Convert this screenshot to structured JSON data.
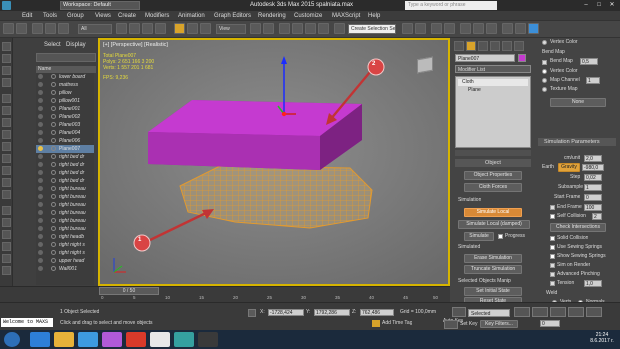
{
  "app": {
    "title": "Autodesk 3ds Max 2015    spalniata.max",
    "workspace": "Workspace: Default",
    "search_placeholder": "Type a keyword or phrase"
  },
  "menu": [
    "Edit",
    "Tools",
    "Group",
    "Views",
    "Create",
    "Modifiers",
    "Animation",
    "Graph Editors",
    "Rendering",
    "Customize",
    "MAXScript",
    "Help"
  ],
  "toolbar": {
    "undo_filter": "All",
    "view_dropdown": "View",
    "selection_set": "Create Selection Se"
  },
  "explorer": {
    "tabs": [
      "Select",
      "Display"
    ],
    "name_header": "Name",
    "items": [
      {
        "label": "lower board",
        "selected": false
      },
      {
        "label": "mattress",
        "selected": false
      },
      {
        "label": "pillow",
        "selected": false
      },
      {
        "label": "pillow001",
        "selected": false
      },
      {
        "label": "Plane001",
        "selected": false
      },
      {
        "label": "Plane002",
        "selected": false
      },
      {
        "label": "Plane003",
        "selected": false
      },
      {
        "label": "Plane004",
        "selected": false
      },
      {
        "label": "Plane006",
        "selected": false
      },
      {
        "label": "Plane007",
        "selected": true
      },
      {
        "label": "right bed dr",
        "selected": false
      },
      {
        "label": "right bed dr",
        "selected": false
      },
      {
        "label": "right bed dr",
        "selected": false
      },
      {
        "label": "right bed dr",
        "selected": false
      },
      {
        "label": "right bureau",
        "selected": false
      },
      {
        "label": "right bureau",
        "selected": false
      },
      {
        "label": "right bureau",
        "selected": false
      },
      {
        "label": "right bureau",
        "selected": false
      },
      {
        "label": "right bureau",
        "selected": false
      },
      {
        "label": "right bureau",
        "selected": false
      },
      {
        "label": "right headb",
        "selected": false
      },
      {
        "label": "right night s",
        "selected": false
      },
      {
        "label": "right night s",
        "selected": false
      },
      {
        "label": "upper head",
        "selected": false
      },
      {
        "label": "Wall001",
        "selected": false
      }
    ]
  },
  "viewport": {
    "label": "[+] [Perspective] [Realistic]",
    "stats_header": "Total     Plane007",
    "polys": "Polys:  2 651 166   3 200",
    "verts": "Verts:  1 557 201   1 681",
    "fps": "FPS:     9,236",
    "callout1": "1",
    "callout2": "2"
  },
  "command_panel": {
    "object_name": "Plane007",
    "modifier_list": "Modifier List",
    "stack": [
      "Cloth",
      "Plane"
    ],
    "section_object": "Object",
    "object_properties": "Object Properties",
    "cloth_forces": "Cloth Forces",
    "section_simulation": "Simulation",
    "simulate_local": "Simulate Local",
    "simulate_local_damped": "Simulate Local (damped)",
    "simulate": "Simulate",
    "progress_label": "Progress",
    "simulated_label": "Simulated",
    "erase_simulation": "Erase Simulation",
    "truncate_simulation": "Truncate Simulation",
    "section_selected": "Selected Objects Manip",
    "set_initial_state": "Set Initial State",
    "reset_state": "Reset State"
  },
  "right_panel": {
    "vertex_color_top": "Vertex Color",
    "section_bend": "Bend Map",
    "bend_map": "Bend Map",
    "bend_value": "0,5",
    "vertex_color": "Vertex Color",
    "map_channel": "Map Channel",
    "map_channel_value": "1",
    "texture_map": "Texture Map",
    "none_button": "None",
    "section_sim_params": "Simulation Parameters",
    "cm_unit": "cm/unit",
    "cm_unit_value": "2,0",
    "earth": "Earth",
    "gravity": "Gravity",
    "gravity_value": "-980,0",
    "step": "Step",
    "step_value": "0,02",
    "subsample": "Subsample",
    "subsample_value": "1",
    "start_frame": "Start Frame",
    "start_frame_value": "0",
    "end_frame": "End Frame",
    "end_frame_value": "100",
    "self_collision": "Self Collision",
    "self_collision_value": "2",
    "check_intersections": "Check Intersections",
    "solid_collision": "Solid Collision",
    "use_sewing_springs": "Use Sewing Springs",
    "show_sewing_springs": "Show Sewing Springs",
    "sim_on_render": "Sim on Render",
    "advanced_pinching": "Advanced Pinching",
    "tension": "Tension",
    "tension_value": "1,0",
    "weld": "Weld",
    "verts": "Verts",
    "normals": "Normals"
  },
  "timeline": {
    "slider": "0 / 50",
    "ticks": [
      "0",
      "5",
      "10",
      "15",
      "20",
      "25",
      "30",
      "35",
      "40",
      "45",
      "50"
    ]
  },
  "status": {
    "selection": "1 Object Selected",
    "prompt": "Click and drag to select and move objects",
    "x": "-1728,424",
    "y": "1792,286",
    "z": "762,486",
    "grid": "Grid = 100,0mm",
    "add_time_tag": "Add Time Tag",
    "auto_key": "Auto Key",
    "selected_dropdown": "Selected",
    "set_key": "Set Key",
    "key_filters": "Key Filters...",
    "frame_value": "0",
    "maxscript": "Welcome to MAXS"
  },
  "taskbar": {
    "time": "21:24",
    "date": "8.6.2017 г."
  }
}
